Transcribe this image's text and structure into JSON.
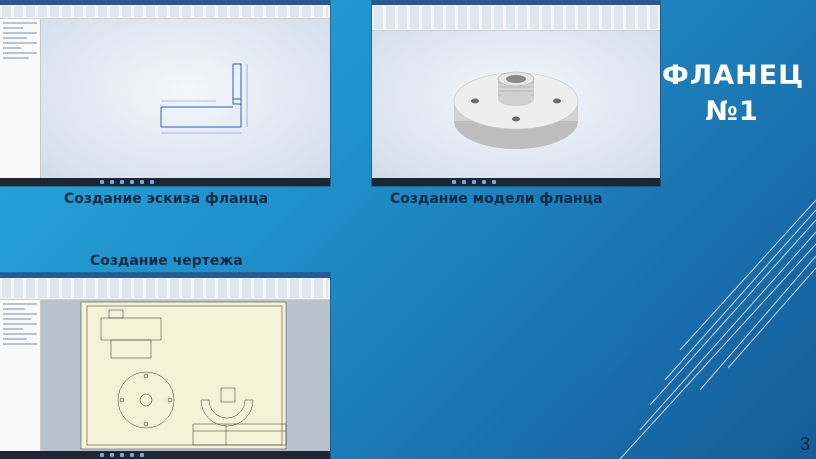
{
  "slide": {
    "title_line1": "ФЛАНЕЦ",
    "title_line2": "№1",
    "page_number": "3"
  },
  "captions": {
    "sketch": "Создание эскиза фланца",
    "model": "Создание модели фланца",
    "drawing": "Создание чертежа"
  },
  "colors": {
    "background_start": "#29a9de",
    "background_end": "#165c97",
    "caption_text": "#102a44",
    "title_text": "#ffffff",
    "sketch_lines": "#1e64d2",
    "model_body": "#e0e0e0",
    "drawing_paper": "#f5f3d7"
  },
  "screenshots": [
    {
      "name": "sketch-screenshot",
      "app": "inventor",
      "content": "2d-sketch"
    },
    {
      "name": "model-screenshot",
      "app": "inventor",
      "content": "3d-flange-model"
    },
    {
      "name": "drawing-screenshot",
      "app": "inventor",
      "content": "2d-drawing"
    }
  ]
}
